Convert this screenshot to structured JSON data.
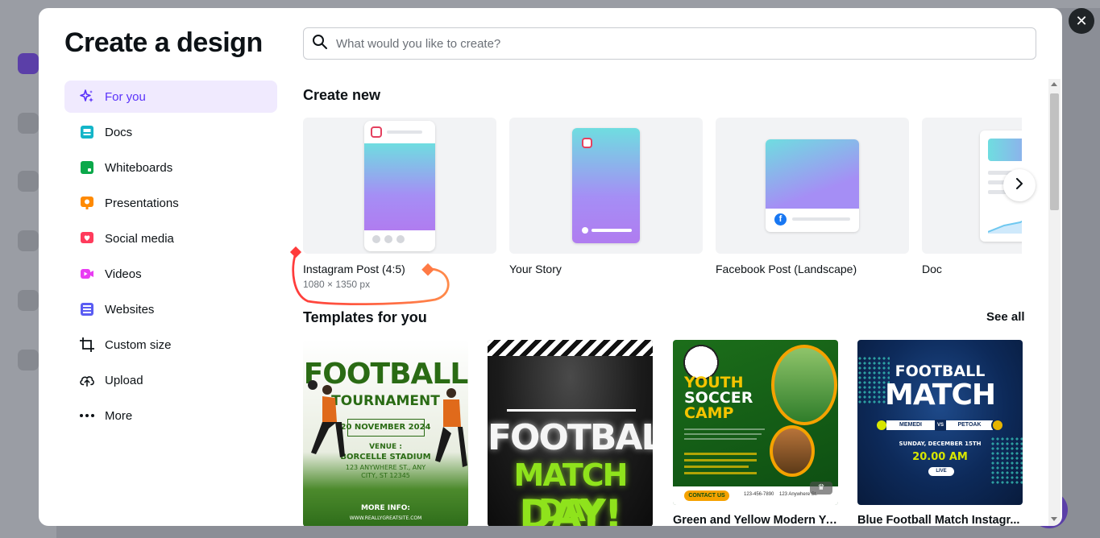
{
  "title": "Create a design",
  "search": {
    "placeholder": "What would you like to create?"
  },
  "nav": [
    {
      "label": "For you",
      "icon": "sparkle-icon",
      "color": "#5a32fa"
    },
    {
      "label": "Docs",
      "icon": "docs-icon",
      "color": "#13b5c8"
    },
    {
      "label": "Whiteboards",
      "icon": "whiteboard-icon",
      "color": "#0ba84a"
    },
    {
      "label": "Presentations",
      "icon": "presentation-icon",
      "color": "#ff8a00"
    },
    {
      "label": "Social media",
      "icon": "heart-icon",
      "color": "#ff3b5c"
    },
    {
      "label": "Videos",
      "icon": "video-icon",
      "color": "#e93cf3"
    },
    {
      "label": "Websites",
      "icon": "website-icon",
      "color": "#5a5cf3"
    },
    {
      "label": "Custom size",
      "icon": "crop-icon",
      "color": "#0d1216"
    },
    {
      "label": "Upload",
      "icon": "cloud-upload-icon",
      "color": "#0d1216"
    },
    {
      "label": "More",
      "icon": "more-icon",
      "color": "#0d1216"
    }
  ],
  "create_new": {
    "heading": "Create new",
    "items": [
      {
        "label": "Instagram Post (4:5)",
        "sub": "1080 × 1350 px"
      },
      {
        "label": "Your Story"
      },
      {
        "label": "Facebook Post (Landscape)"
      },
      {
        "label": "Doc"
      }
    ]
  },
  "templates": {
    "heading": "Templates for you",
    "see_all": "See all",
    "items": [
      {
        "name": "",
        "lines": [
          "FOOTBALL",
          "TOURNAMENT",
          "20 NOVEMBER 2024",
          "VENUE :",
          "BORCELLE STADIUM",
          "123 ANYWHERE ST., ANY",
          "CITY, ST 12345",
          "MORE INFO:",
          "WWW.REALLYGREATSITE.COM"
        ]
      },
      {
        "name": "",
        "lines": [
          "FOOTBALL",
          "MATCH DAY",
          "DAY!"
        ]
      },
      {
        "name": "Green and Yellow Modern Yo...",
        "lines": [
          "YOUTH",
          "SOCCER",
          "CAMP",
          "CONTACT US",
          "123-456-7890",
          "123 Anywhere St."
        ]
      },
      {
        "name": "Blue Football Match Instagr...",
        "lines": [
          "FOOTBALL",
          "MATCH",
          "MEMEDI",
          "VS",
          "PETOAK",
          "SUNDAY, DECEMBER 15TH",
          "20.00 AM",
          "LIVE"
        ]
      }
    ]
  },
  "colors": {
    "accent": "#5a32fa",
    "dark": "#0d1216",
    "highlight": "#f0eafe"
  }
}
